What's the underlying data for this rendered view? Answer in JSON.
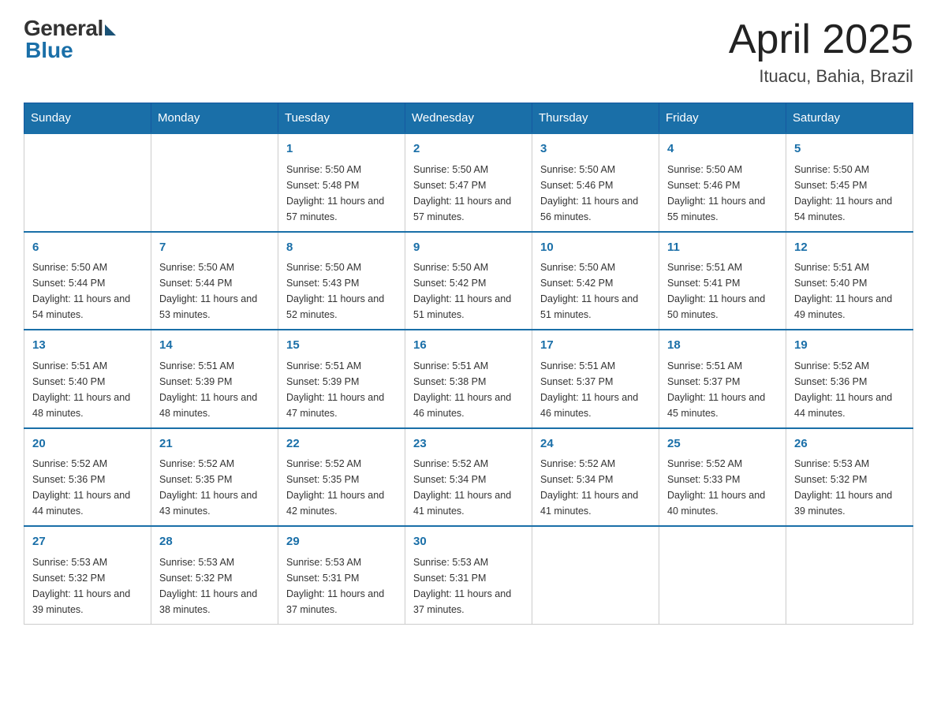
{
  "header": {
    "logo_general": "General",
    "logo_blue": "Blue",
    "month_year": "April 2025",
    "location": "Ituacu, Bahia, Brazil"
  },
  "days_of_week": [
    "Sunday",
    "Monday",
    "Tuesday",
    "Wednesday",
    "Thursday",
    "Friday",
    "Saturday"
  ],
  "weeks": [
    [
      null,
      null,
      {
        "day": "1",
        "sunrise": "5:50 AM",
        "sunset": "5:48 PM",
        "daylight": "11 hours and 57 minutes."
      },
      {
        "day": "2",
        "sunrise": "5:50 AM",
        "sunset": "5:47 PM",
        "daylight": "11 hours and 57 minutes."
      },
      {
        "day": "3",
        "sunrise": "5:50 AM",
        "sunset": "5:46 PM",
        "daylight": "11 hours and 56 minutes."
      },
      {
        "day": "4",
        "sunrise": "5:50 AM",
        "sunset": "5:46 PM",
        "daylight": "11 hours and 55 minutes."
      },
      {
        "day": "5",
        "sunrise": "5:50 AM",
        "sunset": "5:45 PM",
        "daylight": "11 hours and 54 minutes."
      }
    ],
    [
      {
        "day": "6",
        "sunrise": "5:50 AM",
        "sunset": "5:44 PM",
        "daylight": "11 hours and 54 minutes."
      },
      {
        "day": "7",
        "sunrise": "5:50 AM",
        "sunset": "5:44 PM",
        "daylight": "11 hours and 53 minutes."
      },
      {
        "day": "8",
        "sunrise": "5:50 AM",
        "sunset": "5:43 PM",
        "daylight": "11 hours and 52 minutes."
      },
      {
        "day": "9",
        "sunrise": "5:50 AM",
        "sunset": "5:42 PM",
        "daylight": "11 hours and 51 minutes."
      },
      {
        "day": "10",
        "sunrise": "5:50 AM",
        "sunset": "5:42 PM",
        "daylight": "11 hours and 51 minutes."
      },
      {
        "day": "11",
        "sunrise": "5:51 AM",
        "sunset": "5:41 PM",
        "daylight": "11 hours and 50 minutes."
      },
      {
        "day": "12",
        "sunrise": "5:51 AM",
        "sunset": "5:40 PM",
        "daylight": "11 hours and 49 minutes."
      }
    ],
    [
      {
        "day": "13",
        "sunrise": "5:51 AM",
        "sunset": "5:40 PM",
        "daylight": "11 hours and 48 minutes."
      },
      {
        "day": "14",
        "sunrise": "5:51 AM",
        "sunset": "5:39 PM",
        "daylight": "11 hours and 48 minutes."
      },
      {
        "day": "15",
        "sunrise": "5:51 AM",
        "sunset": "5:39 PM",
        "daylight": "11 hours and 47 minutes."
      },
      {
        "day": "16",
        "sunrise": "5:51 AM",
        "sunset": "5:38 PM",
        "daylight": "11 hours and 46 minutes."
      },
      {
        "day": "17",
        "sunrise": "5:51 AM",
        "sunset": "5:37 PM",
        "daylight": "11 hours and 46 minutes."
      },
      {
        "day": "18",
        "sunrise": "5:51 AM",
        "sunset": "5:37 PM",
        "daylight": "11 hours and 45 minutes."
      },
      {
        "day": "19",
        "sunrise": "5:52 AM",
        "sunset": "5:36 PM",
        "daylight": "11 hours and 44 minutes."
      }
    ],
    [
      {
        "day": "20",
        "sunrise": "5:52 AM",
        "sunset": "5:36 PM",
        "daylight": "11 hours and 44 minutes."
      },
      {
        "day": "21",
        "sunrise": "5:52 AM",
        "sunset": "5:35 PM",
        "daylight": "11 hours and 43 minutes."
      },
      {
        "day": "22",
        "sunrise": "5:52 AM",
        "sunset": "5:35 PM",
        "daylight": "11 hours and 42 minutes."
      },
      {
        "day": "23",
        "sunrise": "5:52 AM",
        "sunset": "5:34 PM",
        "daylight": "11 hours and 41 minutes."
      },
      {
        "day": "24",
        "sunrise": "5:52 AM",
        "sunset": "5:34 PM",
        "daylight": "11 hours and 41 minutes."
      },
      {
        "day": "25",
        "sunrise": "5:52 AM",
        "sunset": "5:33 PM",
        "daylight": "11 hours and 40 minutes."
      },
      {
        "day": "26",
        "sunrise": "5:53 AM",
        "sunset": "5:32 PM",
        "daylight": "11 hours and 39 minutes."
      }
    ],
    [
      {
        "day": "27",
        "sunrise": "5:53 AM",
        "sunset": "5:32 PM",
        "daylight": "11 hours and 39 minutes."
      },
      {
        "day": "28",
        "sunrise": "5:53 AM",
        "sunset": "5:32 PM",
        "daylight": "11 hours and 38 minutes."
      },
      {
        "day": "29",
        "sunrise": "5:53 AM",
        "sunset": "5:31 PM",
        "daylight": "11 hours and 37 minutes."
      },
      {
        "day": "30",
        "sunrise": "5:53 AM",
        "sunset": "5:31 PM",
        "daylight": "11 hours and 37 minutes."
      },
      null,
      null,
      null
    ]
  ],
  "labels": {
    "sunrise": "Sunrise:",
    "sunset": "Sunset:",
    "daylight": "Daylight:"
  }
}
